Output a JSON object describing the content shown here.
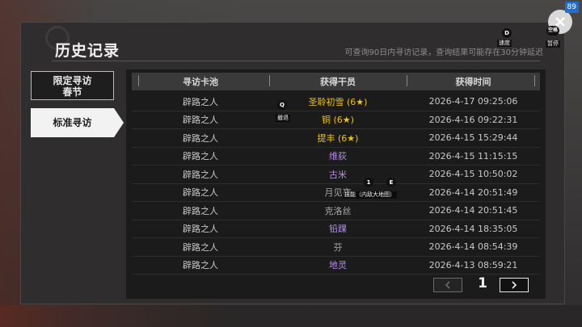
{
  "dialog": {
    "title": "历史记录",
    "notice": "可查询90日内寻访记录，查询结果可能存在30分钟延迟"
  },
  "tabs": {
    "limited": {
      "line1": "限定寻访",
      "line2": "春节"
    },
    "standard": {
      "label": "标准寻访"
    }
  },
  "table": {
    "headers": [
      "寻访卡池",
      "获得干员",
      "获得时间"
    ],
    "rows": [
      {
        "pool": "辟路之人",
        "operator": "圣聆初雪 (6★)",
        "rarity": 6,
        "time": "2026-4-17 09:25:06"
      },
      {
        "pool": "辟路之人",
        "operator": "铜 (6★)",
        "rarity": 6,
        "time": "2026-4-16 09:22:31"
      },
      {
        "pool": "辟路之人",
        "operator": "提丰 (6★)",
        "rarity": 6,
        "time": "2026-4-15 15:29:44"
      },
      {
        "pool": "辟路之人",
        "operator": "维荻",
        "rarity": 5,
        "time": "2026-4-15 11:15:15"
      },
      {
        "pool": "辟路之人",
        "operator": "古米",
        "rarity": 5,
        "time": "2026-4-15 10:50:02"
      },
      {
        "pool": "辟路之人",
        "operator": "月见夜",
        "rarity": 4,
        "time": "2026-4-14 20:51:49"
      },
      {
        "pool": "辟路之人",
        "operator": "克洛丝",
        "rarity": 4,
        "time": "2026-4-14 20:51:45"
      },
      {
        "pool": "辟路之人",
        "operator": "铅踝",
        "rarity": 5,
        "time": "2026-4-14 18:35:05"
      },
      {
        "pool": "辟路之人",
        "operator": "芬",
        "rarity": 4,
        "time": "2026-4-14 08:54:39"
      },
      {
        "pool": "辟路之人",
        "operator": "地灵",
        "rarity": 5,
        "time": "2026-4-13 08:59:21"
      }
    ]
  },
  "pagination": {
    "current_page": "1",
    "prev_icon": "chevron-left-icon",
    "next_icon": "chevron-right-icon"
  },
  "close_button": {
    "badge": "89",
    "icon": "close-icon"
  },
  "hotkeys": [
    {
      "key": "D",
      "label": "速度"
    },
    {
      "key": "空格",
      "label": "暂停"
    },
    {
      "key": "Q",
      "label": "撤退"
    },
    {
      "key": "1",
      "label": "技能（内敌大地图）"
    },
    {
      "key": "E",
      "label": ""
    }
  ],
  "colors": {
    "rarity6": "#f1c40f",
    "rarity5": "#b28ee8",
    "rarity4": "#a8a8a8",
    "tab_active_bg": "#f2f2f2"
  }
}
